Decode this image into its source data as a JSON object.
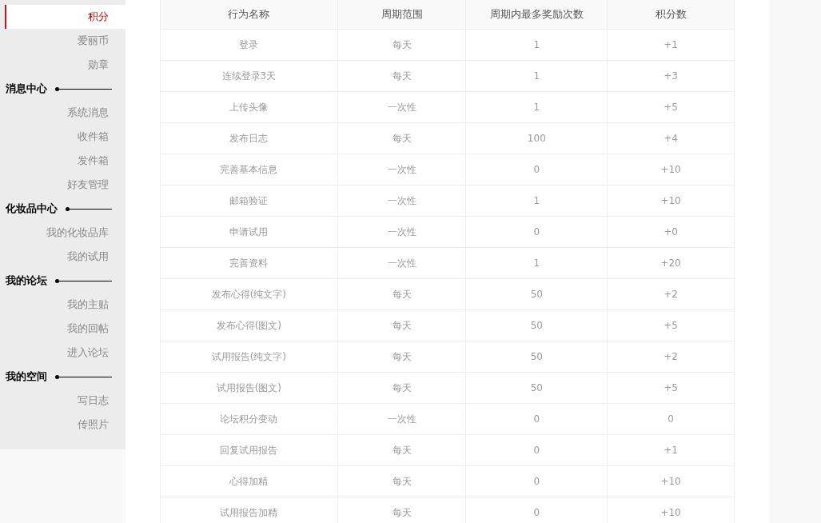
{
  "sidebar": [
    {
      "kind": "item",
      "label": "积分",
      "selected": true
    },
    {
      "kind": "item",
      "label": "爱丽币",
      "selected": false
    },
    {
      "kind": "item",
      "label": "勋章",
      "selected": false
    },
    {
      "kind": "section",
      "label": "消息中心"
    },
    {
      "kind": "item",
      "label": "系统消息",
      "selected": false
    },
    {
      "kind": "item",
      "label": "收件箱",
      "selected": false
    },
    {
      "kind": "item",
      "label": "发件箱",
      "selected": false
    },
    {
      "kind": "item",
      "label": "好友管理",
      "selected": false
    },
    {
      "kind": "section",
      "label": "化妆品中心"
    },
    {
      "kind": "item",
      "label": "我的化妆品库",
      "selected": false
    },
    {
      "kind": "item",
      "label": "我的试用",
      "selected": false
    },
    {
      "kind": "section",
      "label": "我的论坛"
    },
    {
      "kind": "item",
      "label": "我的主贴",
      "selected": false
    },
    {
      "kind": "item",
      "label": "我的回帖",
      "selected": false
    },
    {
      "kind": "item",
      "label": "进入论坛",
      "selected": false
    },
    {
      "kind": "section",
      "label": "我的空间"
    },
    {
      "kind": "item",
      "label": "写日志",
      "selected": false
    },
    {
      "kind": "item",
      "label": "传照片",
      "selected": false
    }
  ],
  "table": {
    "columns": [
      "行为名称",
      "周期范围",
      "周期内最多奖励次数",
      "积分数"
    ],
    "rows": [
      [
        "登录",
        "每天",
        "1",
        "+1"
      ],
      [
        "连续登录3天",
        "每天",
        "1",
        "+3"
      ],
      [
        "上传头像",
        "一次性",
        "1",
        "+5"
      ],
      [
        "发布日志",
        "每天",
        "100",
        "+4"
      ],
      [
        "完善基本信息",
        "一次性",
        "0",
        "+10"
      ],
      [
        "邮箱验证",
        "一次性",
        "1",
        "+10"
      ],
      [
        "申请试用",
        "一次性",
        "0",
        "+0"
      ],
      [
        "完善资料",
        "一次性",
        "1",
        "+20"
      ],
      [
        "发布心得(纯文字)",
        "每天",
        "50",
        "+2"
      ],
      [
        "发布心得(图文)",
        "每天",
        "50",
        "+5"
      ],
      [
        "试用报告(纯文字)",
        "每天",
        "50",
        "+2"
      ],
      [
        "试用报告(图文)",
        "每天",
        "50",
        "+5"
      ],
      [
        "论坛积分变动",
        "一次性",
        "0",
        "0"
      ],
      [
        "回复试用报告",
        "每天",
        "0",
        "+1"
      ],
      [
        "心得加精",
        "每天",
        "0",
        "+10"
      ],
      [
        "试用报告加精",
        "每天",
        "0",
        "+10"
      ]
    ]
  }
}
